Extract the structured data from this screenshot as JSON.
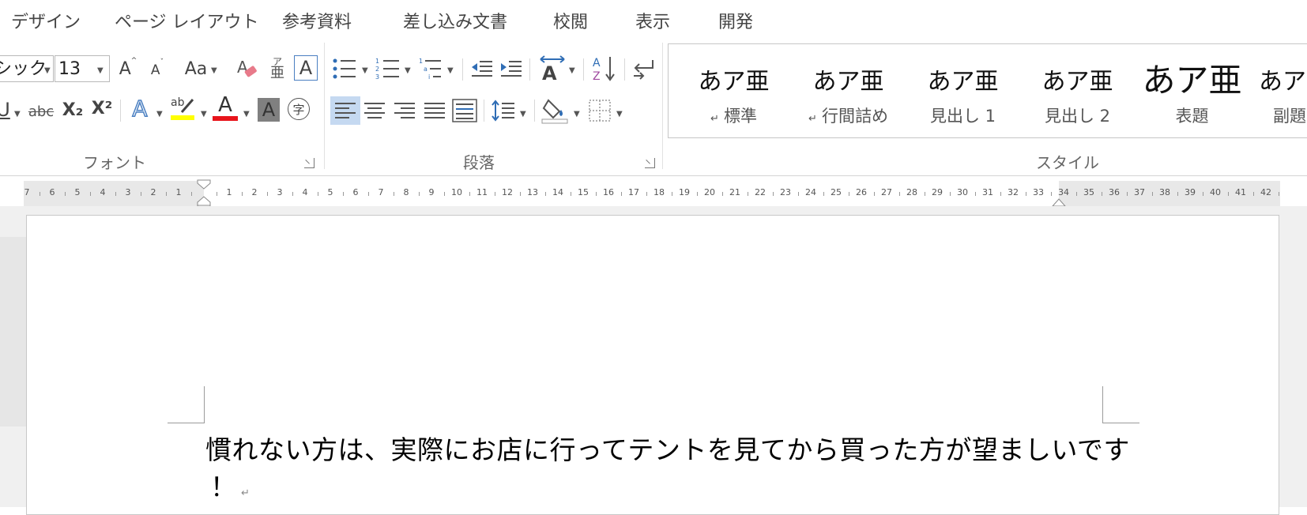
{
  "tabs": [
    "デザイン",
    "ページ レイアウト",
    "参考資料",
    "差し込み文書",
    "校閲",
    "表示",
    "開発"
  ],
  "font": {
    "name_value": "ゴシック",
    "size_value": "13",
    "group_label": "フォント",
    "buttons": {
      "grow": "A",
      "shrink": "A",
      "change_case": "Aa",
      "phonetic_top": "ア",
      "phonetic_bottom": "亜",
      "char_border": "A",
      "underline": "U",
      "strike": "abc",
      "subscript": "X₂",
      "superscript": "X²",
      "text_effects": "A",
      "highlight": "ab",
      "font_color": "A",
      "char_shading": "A",
      "enclose": "字"
    },
    "colors": {
      "highlight": "#ffff00",
      "font_color": "#e8141b",
      "shading": "#808080",
      "effects": "#4a7fc1"
    }
  },
  "paragraph": {
    "group_label": "段落",
    "sort": {
      "a": "A",
      "z": "Z"
    }
  },
  "styles": {
    "group_label": "スタイル",
    "items": [
      {
        "preview": "あア亜",
        "name": "標準",
        "mark": "↵"
      },
      {
        "preview": "あア亜",
        "name": "行間詰め",
        "mark": "↵"
      },
      {
        "preview": "あア亜",
        "name": "見出し 1",
        "mark": ""
      },
      {
        "preview": "あア亜",
        "name": "見出し 2",
        "mark": ""
      },
      {
        "preview": "あア亜",
        "name": "表題",
        "mark": ""
      },
      {
        "preview": "あア",
        "name": "副題",
        "mark": ""
      }
    ]
  },
  "ruler": {
    "left_numbers": [
      "7",
      "6",
      "5",
      "4",
      "3",
      "2",
      "1"
    ],
    "right_numbers": [
      "1",
      "2",
      "3",
      "4",
      "5",
      "6",
      "7",
      "8",
      "9",
      "10",
      "11",
      "12",
      "13",
      "14",
      "15",
      "16",
      "17",
      "18",
      "19",
      "20",
      "21",
      "22",
      "23",
      "24",
      "25",
      "26",
      "27",
      "28",
      "29",
      "30",
      "31",
      "32",
      "33",
      "34",
      "35",
      "36",
      "37",
      "38",
      "39",
      "40",
      "41",
      "42"
    ]
  },
  "document": {
    "line1": "慣れない方は、実際にお店に行ってテントを見てから買った方が望ましいです",
    "line2": "！",
    "pilcrow": "↵"
  }
}
